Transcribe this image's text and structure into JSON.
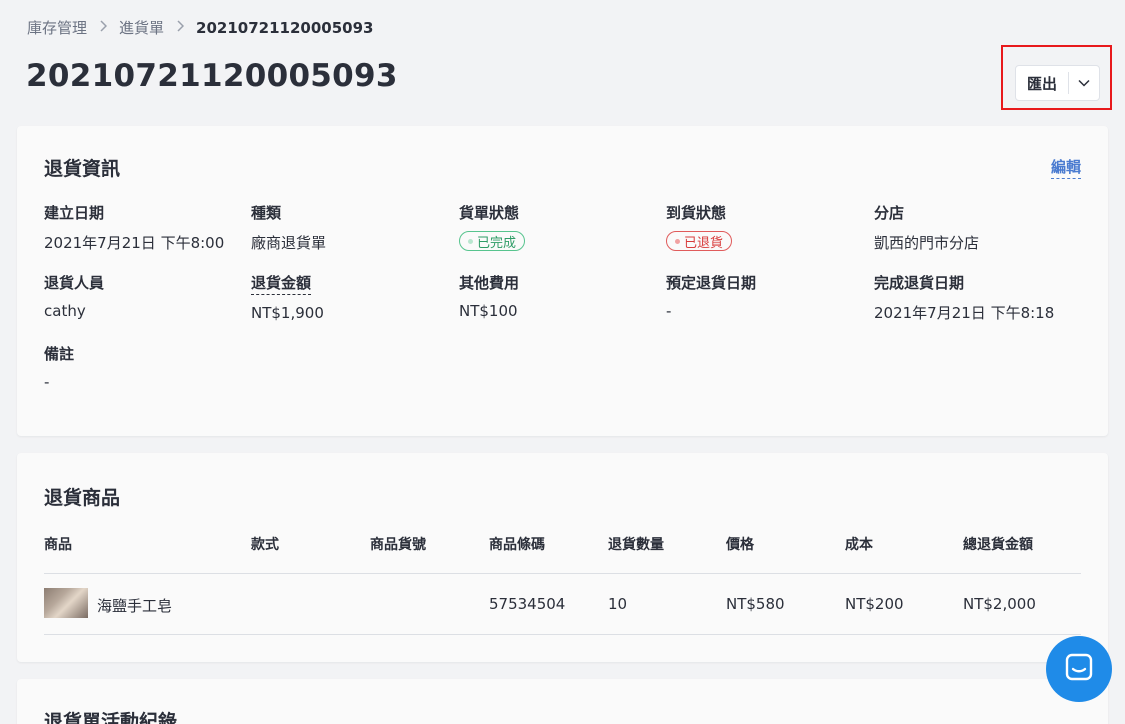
{
  "breadcrumb": {
    "items": [
      "庫存管理",
      "進貨單",
      "20210721120005093"
    ]
  },
  "page": {
    "title": "20210721120005093",
    "export_label": "匯出"
  },
  "return_info": {
    "title": "退貨資訊",
    "edit_label": "編輯",
    "fields": {
      "created_label": "建立日期",
      "created_value": "2021年7月21日 下午8:00",
      "type_label": "種類",
      "type_value": "廠商退貨單",
      "order_status_label": "貨單狀態",
      "order_status_value": "已完成",
      "arrival_status_label": "到貨狀態",
      "arrival_status_value": "已退貨",
      "branch_label": "分店",
      "branch_value": "凱西的門市分店",
      "staff_label": "退貨人員",
      "staff_value": "cathy",
      "amount_label": "退貨金額",
      "amount_value": "NT$1,900",
      "other_fee_label": "其他費用",
      "other_fee_value": "NT$100",
      "scheduled_label": "預定退貨日期",
      "scheduled_value": "-",
      "completed_label": "完成退貨日期",
      "completed_value": "2021年7月21日 下午8:18",
      "note_label": "備註",
      "note_value": "-"
    }
  },
  "return_items": {
    "title": "退貨商品",
    "columns": [
      "商品",
      "款式",
      "商品貨號",
      "商品條碼",
      "退貨數量",
      "價格",
      "成本",
      "總退貨金額"
    ],
    "rows": [
      {
        "product": "海鹽手工皂",
        "variant": "",
        "sku": "",
        "barcode": "57534504",
        "qty": "10",
        "price": "NT$580",
        "cost": "NT$200",
        "total": "NT$2,000"
      }
    ]
  },
  "activity": {
    "title": "退貨單活動紀錄"
  },
  "colors": {
    "accent": "#4a7bd0",
    "success": "#2e9c66",
    "danger": "#d83c3c",
    "chat": "#1f8be8",
    "highlight": "#e8191c"
  },
  "icons": [
    "chevron-right-icon",
    "chevron-down-icon",
    "chat-icon"
  ]
}
